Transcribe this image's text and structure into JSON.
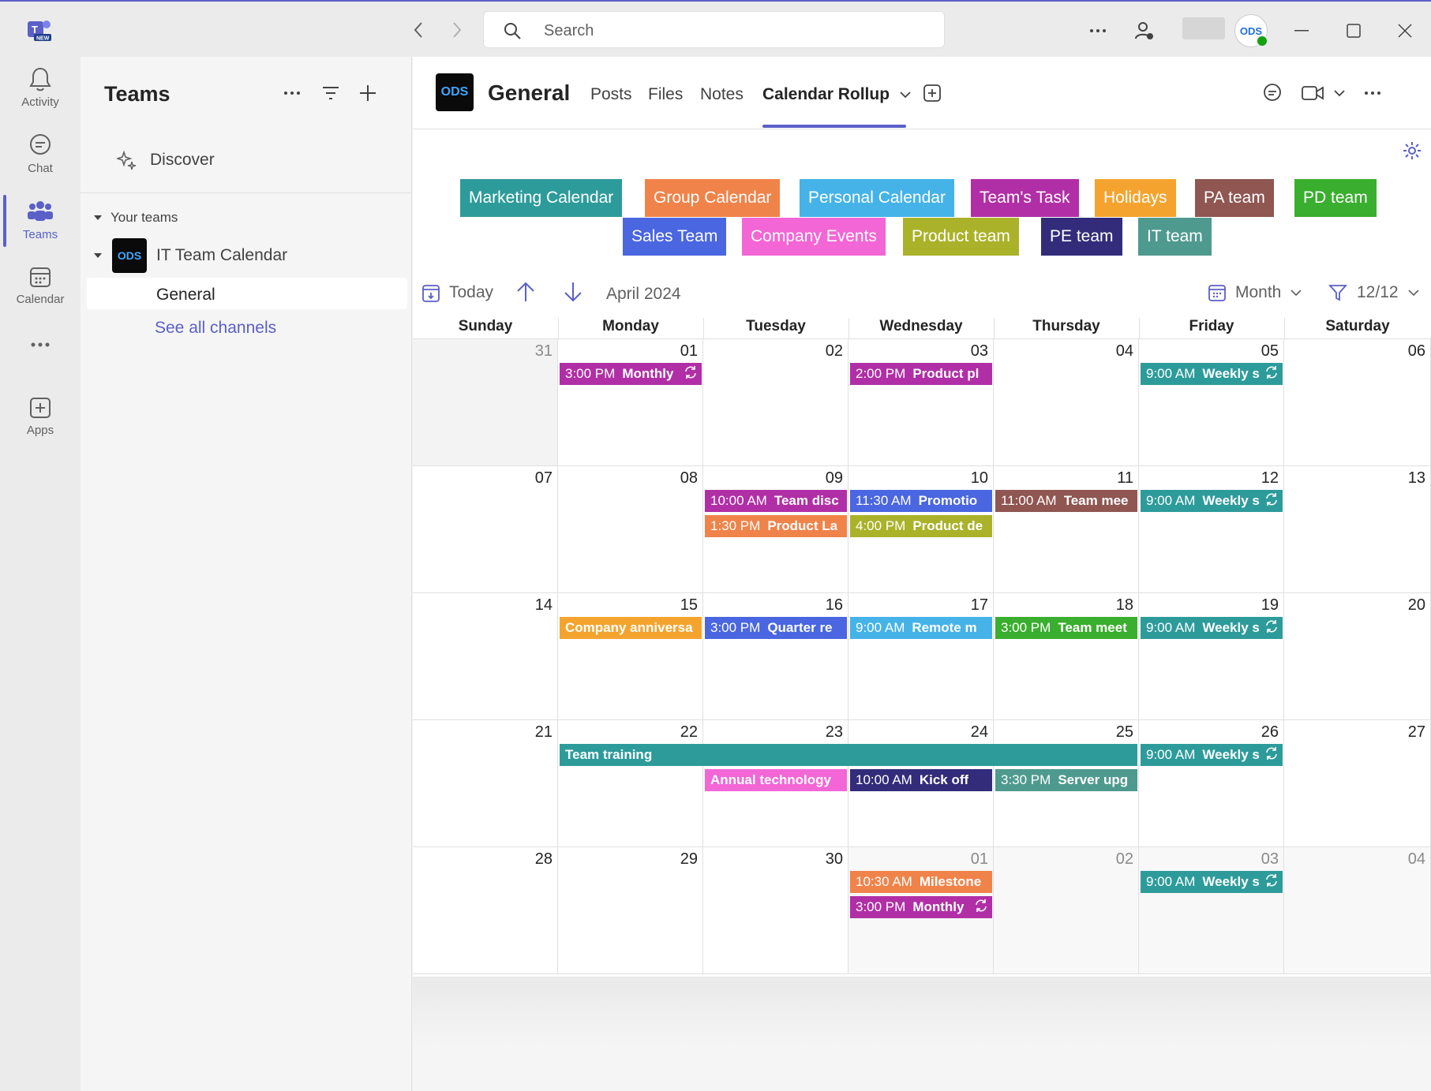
{
  "titlebar": {
    "search_placeholder": "Search",
    "logo_badge": "NEW"
  },
  "rail": [
    {
      "label": "Activity",
      "icon": "bell-icon"
    },
    {
      "label": "Chat",
      "icon": "chat-icon"
    },
    {
      "label": "Teams",
      "icon": "teams-icon",
      "active": true
    },
    {
      "label": "Calendar",
      "icon": "calendar-icon"
    },
    {
      "label": "",
      "icon": "more-icon"
    },
    {
      "label": "Apps",
      "icon": "apps-icon"
    }
  ],
  "teams_panel": {
    "title": "Teams",
    "discover": "Discover",
    "your_teams": "Your teams",
    "team_name": "IT Team Calendar",
    "channel": "General",
    "see_all": "See all channels"
  },
  "channel": {
    "name": "General",
    "tabs": [
      "Posts",
      "Files",
      "Notes",
      "Calendar Rollup"
    ],
    "active_tab": "Calendar Rollup"
  },
  "legend": [
    {
      "label": "Marketing Calendar",
      "color": "#2e9b9b"
    },
    {
      "label": "Group Calendar",
      "color": "#f0834a"
    },
    {
      "label": "Personal Calendar",
      "color": "#45b3e8"
    },
    {
      "label": "Team's Task",
      "color": "#b12fa6"
    },
    {
      "label": "Holidays",
      "color": "#f4a42e"
    },
    {
      "label": "PA team",
      "color": "#8f5652"
    },
    {
      "label": "PD team",
      "color": "#3aae2e"
    },
    {
      "label": "Sales Team",
      "color": "#4a66e0"
    },
    {
      "label": "Company Events",
      "color": "#f266d6"
    },
    {
      "label": "Product team",
      "color": "#aab22a"
    },
    {
      "label": "PE team",
      "color": "#322c7a"
    },
    {
      "label": "IT team",
      "color": "#4f9a8e"
    }
  ],
  "toolbar": {
    "today": "Today",
    "period": "April 2024",
    "view": "Month",
    "filter": "12/12"
  },
  "calendar": {
    "days": [
      "Sunday",
      "Monday",
      "Tuesday",
      "Wednesday",
      "Thursday",
      "Friday",
      "Saturday"
    ],
    "weeks": [
      [
        {
          "d": "31",
          "other": true
        },
        {
          "d": "01"
        },
        {
          "d": "02"
        },
        {
          "d": "03"
        },
        {
          "d": "04"
        },
        {
          "d": "05"
        },
        {
          "d": "06"
        }
      ],
      [
        {
          "d": "07"
        },
        {
          "d": "08"
        },
        {
          "d": "09"
        },
        {
          "d": "10"
        },
        {
          "d": "11"
        },
        {
          "d": "12"
        },
        {
          "d": "13"
        }
      ],
      [
        {
          "d": "14"
        },
        {
          "d": "15"
        },
        {
          "d": "16"
        },
        {
          "d": "17"
        },
        {
          "d": "18"
        },
        {
          "d": "19"
        },
        {
          "d": "20"
        }
      ],
      [
        {
          "d": "21"
        },
        {
          "d": "22"
        },
        {
          "d": "23"
        },
        {
          "d": "24"
        },
        {
          "d": "25"
        },
        {
          "d": "26"
        },
        {
          "d": "27"
        }
      ],
      [
        {
          "d": "28"
        },
        {
          "d": "29"
        },
        {
          "d": "30"
        },
        {
          "d": "01",
          "other": true
        },
        {
          "d": "02",
          "other": true
        },
        {
          "d": "03",
          "other": true
        },
        {
          "d": "04",
          "other": true
        }
      ]
    ],
    "events": [
      {
        "week": 0,
        "day": 1,
        "span": 1,
        "slot": 0,
        "time": "3:00 PM",
        "title": "Monthly",
        "color": "#b12fa6",
        "recurring": true
      },
      {
        "week": 0,
        "day": 3,
        "span": 1,
        "slot": 0,
        "time": "2:00 PM",
        "title": "Product pl",
        "color": "#b12fa6"
      },
      {
        "week": 0,
        "day": 5,
        "span": 1,
        "slot": 0,
        "time": "9:00 AM",
        "title": "Weekly s",
        "color": "#2e9b9b",
        "recurring": true
      },
      {
        "week": 1,
        "day": 2,
        "span": 1,
        "slot": 0,
        "time": "10:00 AM",
        "title": "Team disc",
        "color": "#b12fa6"
      },
      {
        "week": 1,
        "day": 2,
        "span": 1,
        "slot": 1,
        "time": "1:30 PM",
        "title": "Product La",
        "color": "#f0834a"
      },
      {
        "week": 1,
        "day": 3,
        "span": 1,
        "slot": 0,
        "time": "11:30 AM",
        "title": "Promotio",
        "color": "#4a66e0"
      },
      {
        "week": 1,
        "day": 3,
        "span": 1,
        "slot": 1,
        "time": "4:00 PM",
        "title": "Product de",
        "color": "#aab22a"
      },
      {
        "week": 1,
        "day": 4,
        "span": 1,
        "slot": 0,
        "time": "11:00 AM",
        "title": "Team mee",
        "color": "#8f5652"
      },
      {
        "week": 1,
        "day": 5,
        "span": 1,
        "slot": 0,
        "time": "9:00 AM",
        "title": "Weekly s",
        "color": "#2e9b9b",
        "recurring": true
      },
      {
        "week": 2,
        "day": 1,
        "span": 1,
        "slot": 0,
        "time": "",
        "title": "Company anniversa",
        "color": "#f4a42e"
      },
      {
        "week": 2,
        "day": 2,
        "span": 1,
        "slot": 0,
        "time": "3:00 PM",
        "title": "Quarter re",
        "color": "#4a66e0"
      },
      {
        "week": 2,
        "day": 3,
        "span": 1,
        "slot": 0,
        "time": "9:00 AM",
        "title": "Remote m",
        "color": "#45b3e8"
      },
      {
        "week": 2,
        "day": 4,
        "span": 1,
        "slot": 0,
        "time": "3:00 PM",
        "title": "Team meet",
        "color": "#3aae2e"
      },
      {
        "week": 2,
        "day": 5,
        "span": 1,
        "slot": 0,
        "time": "9:00 AM",
        "title": "Weekly s",
        "color": "#2e9b9b",
        "recurring": true
      },
      {
        "week": 3,
        "day": 1,
        "span": 4,
        "slot": 0,
        "time": "",
        "title": "Team training",
        "color": "#2e9b9b"
      },
      {
        "week": 3,
        "day": 2,
        "span": 1,
        "slot": 1,
        "time": "",
        "title": "Annual technology",
        "color": "#f266d6"
      },
      {
        "week": 3,
        "day": 3,
        "span": 1,
        "slot": 1,
        "time": "10:00 AM",
        "title": "Kick off",
        "color": "#322c7a"
      },
      {
        "week": 3,
        "day": 4,
        "span": 1,
        "slot": 1,
        "time": "3:30 PM",
        "title": "Server upg",
        "color": "#4f9a8e"
      },
      {
        "week": 3,
        "day": 5,
        "span": 1,
        "slot": 0,
        "time": "9:00 AM",
        "title": "Weekly s",
        "color": "#2e9b9b",
        "recurring": true
      },
      {
        "week": 4,
        "day": 3,
        "span": 1,
        "slot": 0,
        "time": "10:30 AM",
        "title": "Milestone",
        "color": "#f0834a"
      },
      {
        "week": 4,
        "day": 3,
        "span": 1,
        "slot": 1,
        "time": "3:00 PM",
        "title": "Monthly",
        "color": "#b12fa6",
        "recurring": true
      },
      {
        "week": 4,
        "day": 5,
        "span": 1,
        "slot": 0,
        "time": "9:00 AM",
        "title": "Weekly s",
        "color": "#2e9b9b",
        "recurring": true
      }
    ]
  }
}
